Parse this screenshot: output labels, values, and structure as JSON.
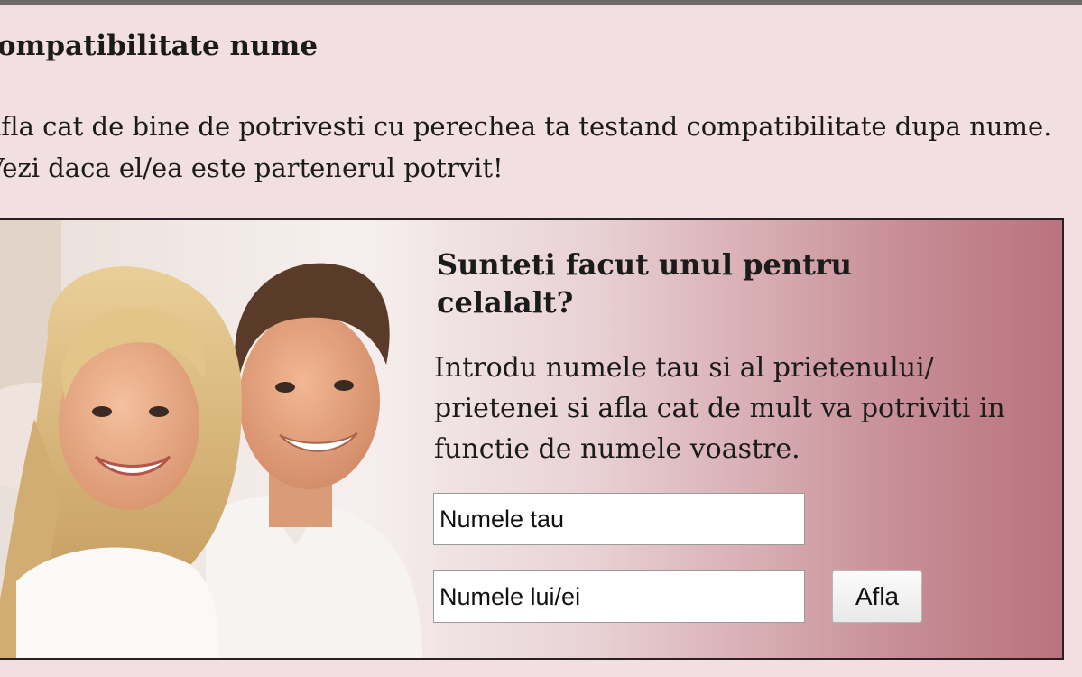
{
  "page": {
    "title": "compatibilitate nume",
    "intro": "afla cat de bine de potrivesti cu perechea ta testand compatibilitate dupa nume. Vezi daca el/ea este partenerul potrvit!"
  },
  "promo": {
    "heading": "Sunteti facut unul pentru celalalt?",
    "text": "Introdu numele tau si al prietenului/ prietenei si afla cat de mult va potriviti in functie de numele voastre.",
    "input_your_name": "Numele tau",
    "input_partner_name": "Numele lui/ei",
    "submit_label": "Afla"
  }
}
